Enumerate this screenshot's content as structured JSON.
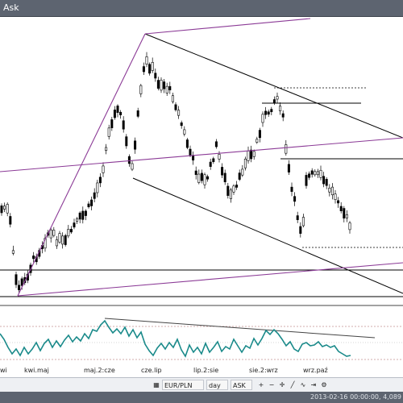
{
  "window": {
    "title": "Ask"
  },
  "date_axis": [
    "wi",
    "kwi.maj",
    "maj.2:cze",
    "cze.lip",
    "lip.2:sie",
    "sie.2:wrz",
    "wrz.paź"
  ],
  "toolbar": {
    "symbol": "EUR/PLN",
    "interval": "day",
    "price_type": "ASK",
    "icons": [
      "chart-type-icon",
      "zoom-in-icon",
      "zoom-out-icon",
      "crosshair-icon",
      "draw-line-icon",
      "indicator-icon",
      "scroll-end-icon",
      "settings-icon"
    ]
  },
  "status": {
    "timestamp": "2013-02-16 00:00:00",
    "price": "4,089"
  },
  "colors": {
    "candles": "#000000",
    "trendlines": "#8b3a96",
    "oscillator": "#1a8a8a",
    "titlebar": "#5d6470"
  }
}
